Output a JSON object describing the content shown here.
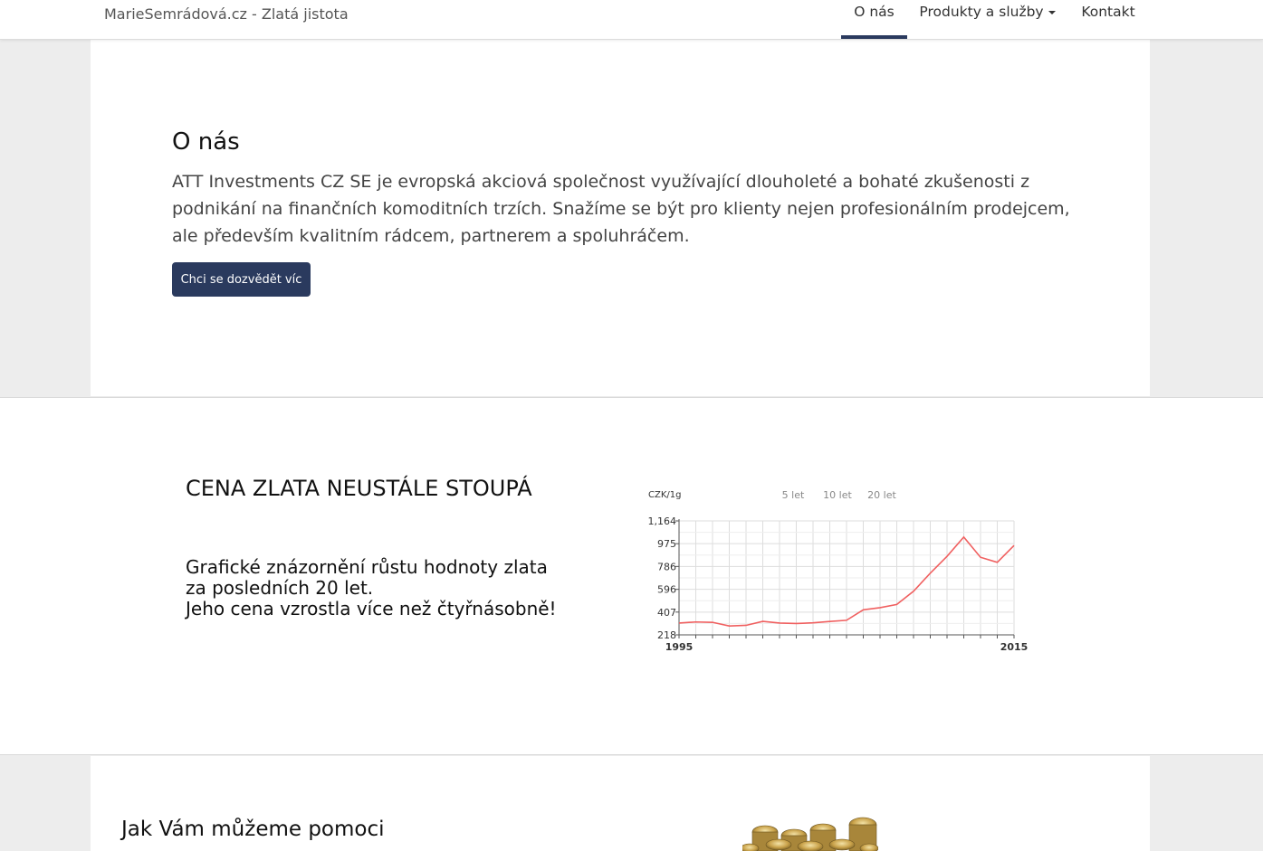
{
  "navbar": {
    "brand": "MarieSemrádová.cz - Zlatá jistota",
    "items": [
      {
        "label": "O nás",
        "active": true
      },
      {
        "label": "Produkty a služby",
        "dropdown": true
      },
      {
        "label": "Kontakt"
      }
    ],
    "accent_color": "#2a3a5e"
  },
  "about": {
    "title": "O nás",
    "text": "ATT Investments CZ SE je evropská akciová společnost využívající dlouholeté a bohaté zkušenosti z podnikání na finančních komoditních trzích. Snažíme se být pro klienty nejen profesionálním prodejcem, ale především kvalitním rádcem, partnerem a spoluhráčem.",
    "button_label": "Chci se dozvědět víc"
  },
  "gold": {
    "title": "CENA ZLATA NEUSTÁLE STOUPÁ",
    "lines": [
      "Grafické znázornění růstu hodnoty zlata",
      "za posledních 20 let.",
      "Jeho cena vzrostla více než čtyřnásobně!"
    ]
  },
  "chart_data": {
    "type": "line",
    "ylabel": "CZK/1g",
    "range_buttons": [
      "5 let",
      "10 let",
      "20 let"
    ],
    "x_tick_labels": [
      "1995",
      "2015"
    ],
    "yticks": [
      218,
      407,
      596,
      786,
      975,
      1164
    ],
    "ytick_labels": [
      "218",
      "407",
      "596",
      "786",
      "975",
      "1,164"
    ],
    "ylim": [
      218,
      1164
    ],
    "xlim": [
      1995,
      2015
    ],
    "grid": true,
    "series_color": "#f06060",
    "x": [
      1995,
      1996,
      1997,
      1998,
      1999,
      2000,
      2001,
      2002,
      2003,
      2004,
      2005,
      2006,
      2007,
      2008,
      2009,
      2010,
      2011,
      2012,
      2013,
      2014,
      2015
    ],
    "values": [
      316,
      325,
      322,
      292,
      297,
      330,
      316,
      312,
      318,
      329,
      339,
      426,
      444,
      470,
      580,
      730,
      870,
      1030,
      862,
      820,
      960
    ],
    "values_note": ""
  },
  "help": {
    "title": "Jak Vám můžeme pomoci"
  }
}
